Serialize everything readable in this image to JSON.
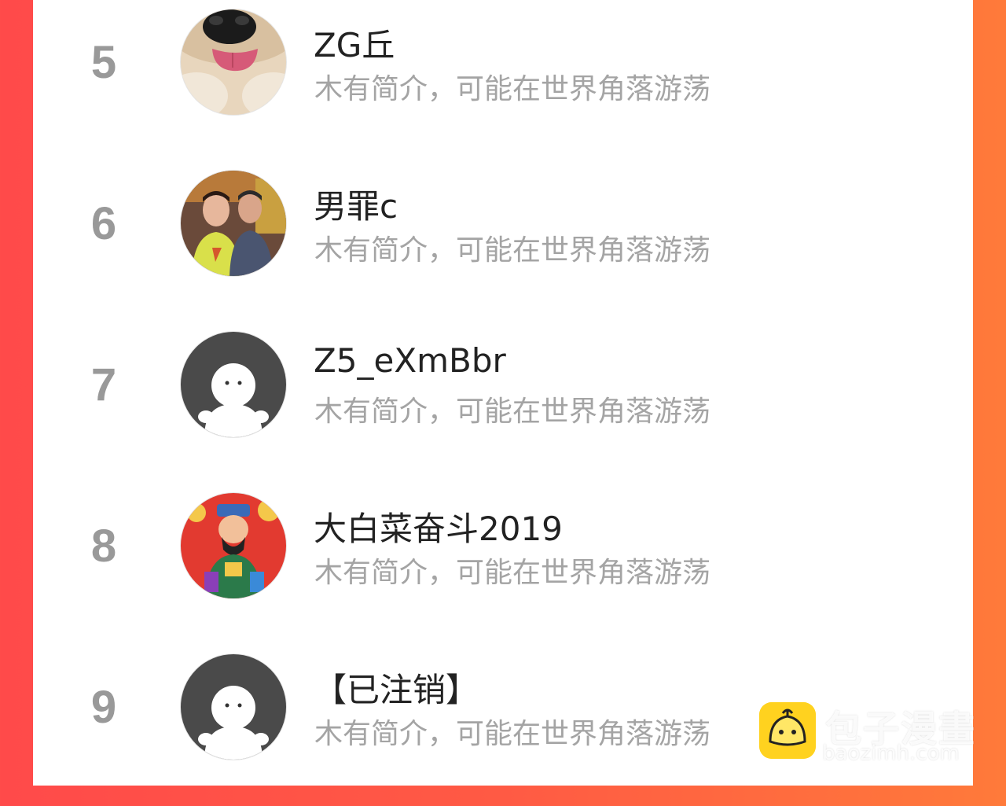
{
  "ranking": [
    {
      "rank": "5",
      "name": "ZG丘",
      "desc": "木有简介，可能在世界角落游荡",
      "avatar_icon": "dog-photo-avatar"
    },
    {
      "rank": "6",
      "name": "男罪c",
      "desc": "木有简介，可能在世界角落游荡",
      "avatar_icon": "two-men-photo-avatar"
    },
    {
      "rank": "7",
      "name": "Z5_eXmBbr",
      "desc": "木有简介，可能在世界角落游荡",
      "avatar_icon": "default-person-avatar"
    },
    {
      "rank": "8",
      "name": "大白菜奋斗2019",
      "desc": "木有简介，可能在世界角落游荡",
      "avatar_icon": "fortune-god-avatar"
    },
    {
      "rank": "9",
      "name": "【已注销】",
      "desc": "木有简介，可能在世界角落游荡",
      "avatar_icon": "default-person-avatar"
    }
  ],
  "watermark": {
    "title": "包子漫畫",
    "url": "baozimh.com"
  },
  "colors": {
    "background_left": "#ff4a4a",
    "background_right": "#ff7a3a",
    "rank": "#999999",
    "name": "#222222",
    "desc": "#a4a4a4"
  }
}
